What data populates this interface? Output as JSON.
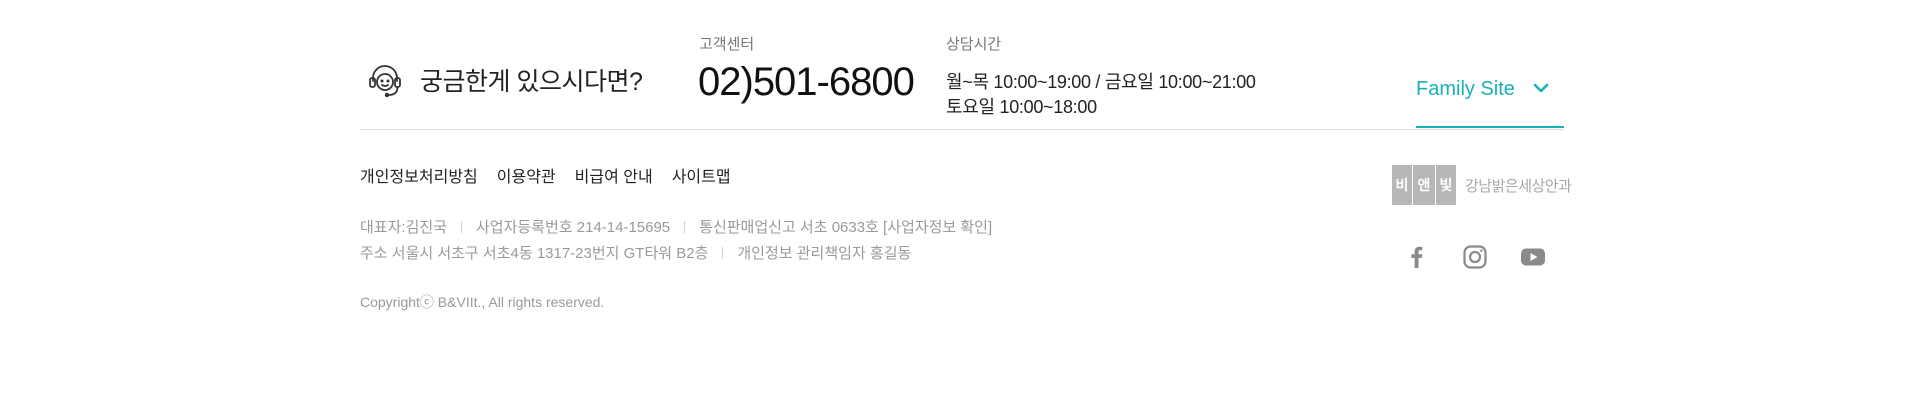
{
  "contact": {
    "question": "궁금한게 있으시다면?",
    "cs_label": "고객센터",
    "phone": "02)501-6800",
    "hours_label": "상담시간",
    "hours_line1": "월~목 10:00~19:00 / 금요일 10:00~21:00",
    "hours_line2": "토요일 10:00~18:00"
  },
  "family_site": {
    "label": "Family Site"
  },
  "links": [
    "개인정보처리방침",
    "이용약관",
    "비급여 안내",
    "사이트맵"
  ],
  "company": {
    "ceo": "대표자:김진국",
    "business_no": "사업자등록번호  214-14-15695",
    "mail_order": "통신판매업신고 서초 0633호 [사업자정보 확인]",
    "address": "주소 서울시 서초구 서초4동 1317-23번지 GT타워 B2층",
    "privacy_officer": "개인정보 관리책임자 홍길동",
    "copyright": "Copyrightⓒ B&VIIt., All rights reserved."
  },
  "logo": {
    "mark": [
      "비",
      "앤",
      "빛"
    ],
    "text": "강남밝은세상안과"
  },
  "colors": {
    "accent": "#18b2b6",
    "text": "#222222",
    "muted": "#9a9a9a",
    "icon": "#8a8a8a"
  },
  "icons": {
    "headset": "headset-icon",
    "chevron": "chevron-down-icon",
    "social": [
      "facebook-icon",
      "instagram-icon",
      "youtube-icon"
    ]
  }
}
